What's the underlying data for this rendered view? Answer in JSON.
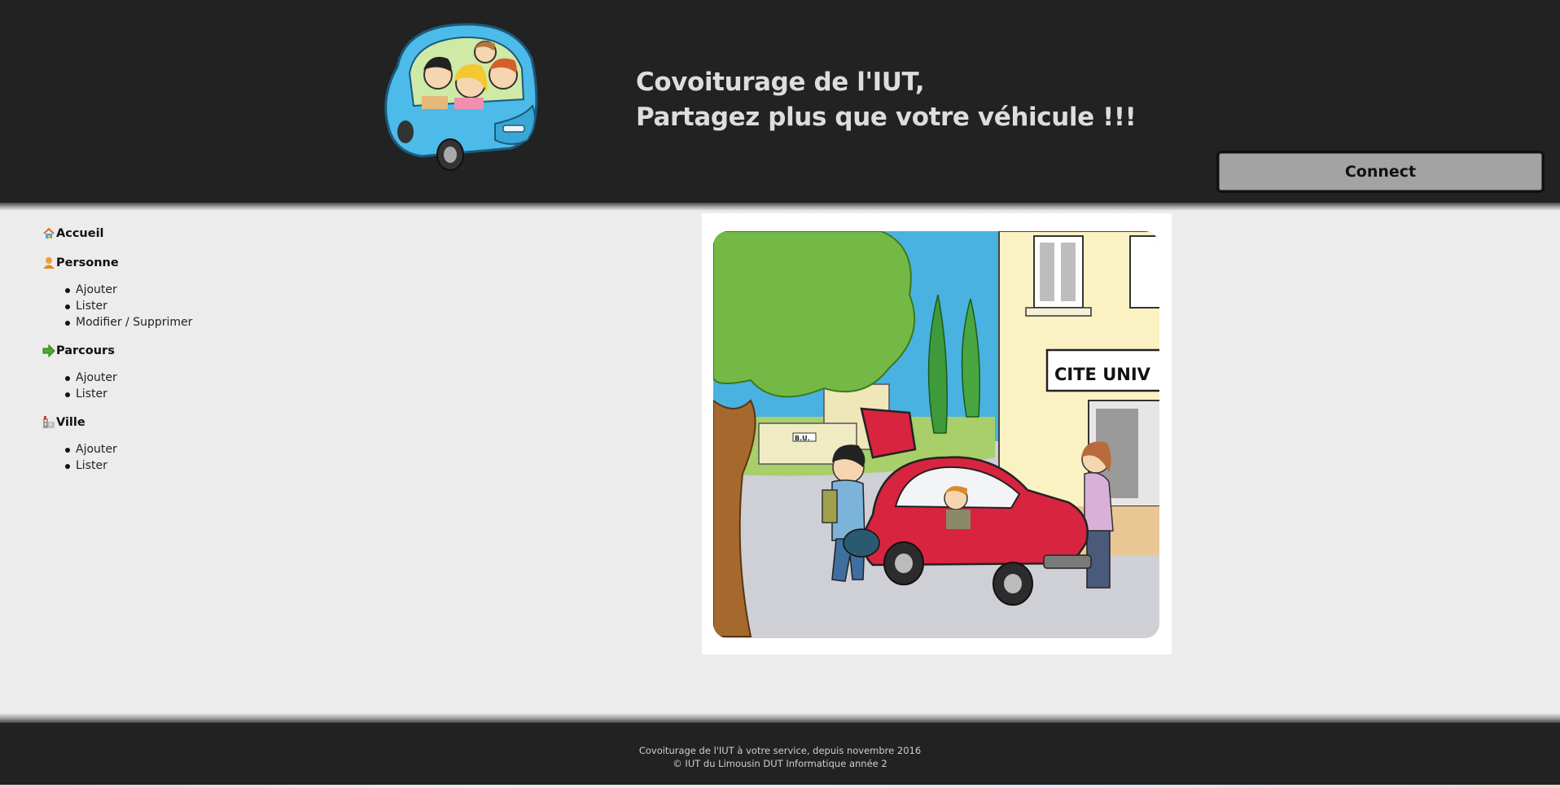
{
  "header": {
    "title_line1": "Covoiturage de l'IUT,",
    "title_line2": "Partagez plus que votre véhicule !!!",
    "logo_icon": "carpool-car-logo",
    "connect_label": "Connect"
  },
  "sidebar": {
    "sections": [
      {
        "label": "Accueil",
        "icon": "home-icon",
        "items": []
      },
      {
        "label": "Personne",
        "icon": "person-icon",
        "items": [
          "Ajouter",
          "Lister",
          "Modifier / Supprimer"
        ]
      },
      {
        "label": "Parcours",
        "icon": "arrow-icon",
        "items": [
          "Ajouter",
          "Lister"
        ]
      },
      {
        "label": "Ville",
        "icon": "city-icon",
        "items": [
          "Ajouter",
          "Lister"
        ]
      }
    ]
  },
  "main": {
    "image_sign_text": "CITE UNIV",
    "image_small_sign": "B.U."
  },
  "footer": {
    "line1": "Covoiturage de l'IUT à votre service, depuis novembre 2016",
    "line2": "© IUT du Limousin DUT Informatique année 2"
  },
  "colors": {
    "header_bg": "#222222",
    "page_bg": "#ececec",
    "title_text": "#dddddd",
    "button_bg": "#a3a3a3",
    "car_red": "#d9243f",
    "car_blue": "#45b8e8"
  }
}
